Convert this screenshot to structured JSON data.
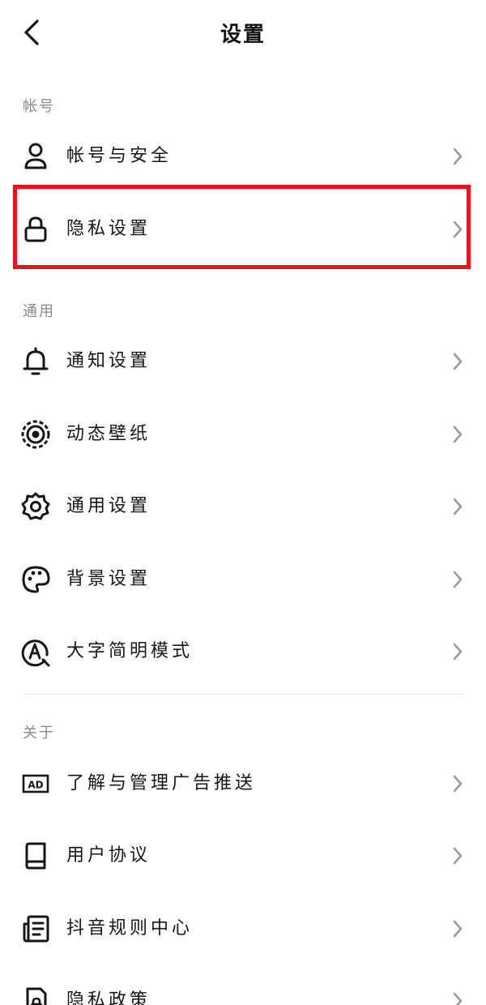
{
  "header": {
    "title": "设置"
  },
  "sections": {
    "account": {
      "label": "帐号"
    },
    "general": {
      "label": "通用"
    },
    "about": {
      "label": "关于"
    }
  },
  "items": {
    "account_security": {
      "label": "帐号与安全",
      "icon": "user-icon"
    },
    "privacy_settings": {
      "label": "隐私设置",
      "icon": "lock-icon"
    },
    "notification_settings": {
      "label": "通知设置",
      "icon": "bell-icon"
    },
    "live_wallpaper": {
      "label": "动态壁纸",
      "icon": "wallpaper-icon"
    },
    "general_settings": {
      "label": "通用设置",
      "icon": "gear-icon"
    },
    "background_settings": {
      "label": "背景设置",
      "icon": "palette-icon"
    },
    "large_text_mode": {
      "label": "大字简明模式",
      "icon": "font-size-icon"
    },
    "ad_management": {
      "label": "了解与管理广告推送",
      "icon": "ad-icon"
    },
    "user_agreement": {
      "label": "用户协议",
      "icon": "book-icon"
    },
    "community_rules": {
      "label": "抖音规则中心",
      "icon": "document-list-icon"
    },
    "privacy_policy": {
      "label": "隐私政策",
      "icon": "privacy-doc-icon"
    }
  },
  "highlight": {
    "color": "#e8141c",
    "target": "privacy_settings"
  }
}
